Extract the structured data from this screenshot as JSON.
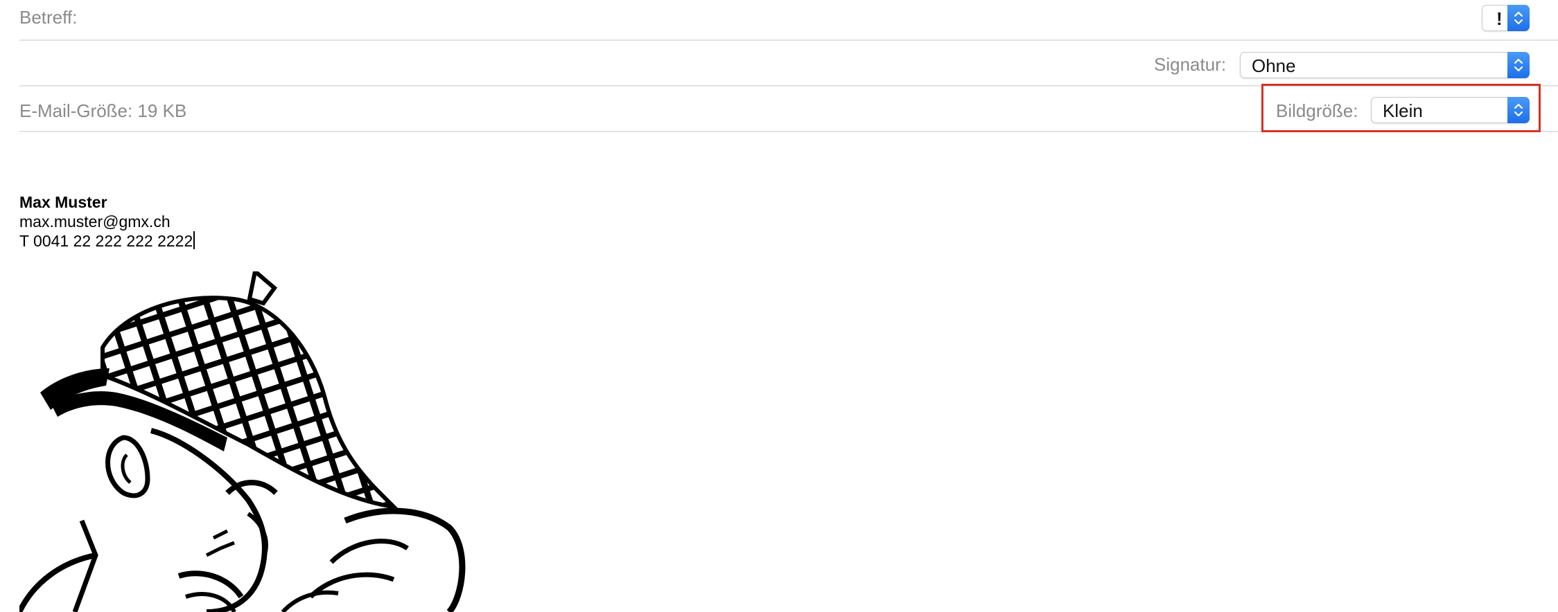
{
  "header": {
    "subject_label": "Betreff:",
    "priority_value": "!",
    "signature_label": "Signatur:",
    "signature_value": "Ohne",
    "message_size_label": "E-Mail-Größe: 19 KB",
    "image_size_label": "Bildgröße:",
    "image_size_value": "Klein"
  },
  "body": {
    "name": "Max Muster",
    "email": "max.muster@gmx.ch",
    "phone": "T 0041 22 222 222 2222"
  },
  "colors": {
    "highlight": "#d93025",
    "stepper_blue": "#1e6fe8",
    "label_gray": "#8a8a8a"
  },
  "icons": {
    "stepper": "up-down-chevron-icon",
    "illustration": "detective-sherlock-cartoon"
  }
}
